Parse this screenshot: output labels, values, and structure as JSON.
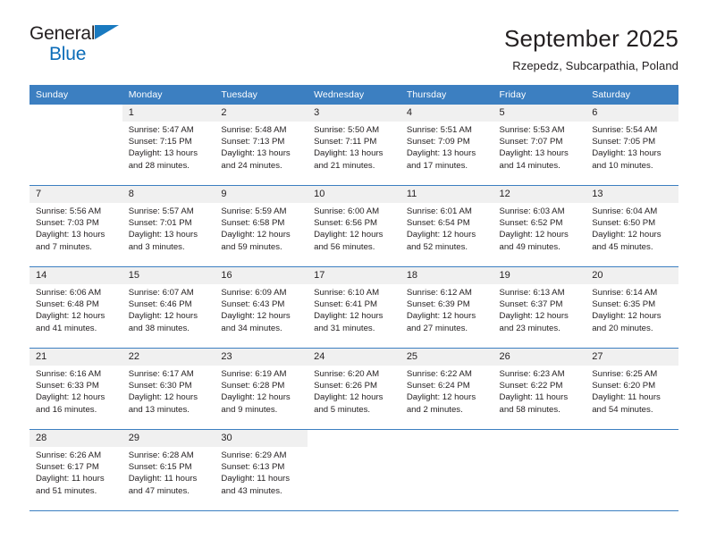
{
  "brand": {
    "word_one": "General",
    "word_two": "Blue",
    "flag_icon": "triangle-flag-icon"
  },
  "header": {
    "title": "September 2025",
    "subtitle": "Rzepedz, Subcarpathia, Poland"
  },
  "colors": {
    "header_blue": "#3c7fc1",
    "brand_blue": "#0b6cb8",
    "daynum_bg": "#f0f0f0",
    "text": "#231f20"
  },
  "weekday_headers": [
    "Sunday",
    "Monday",
    "Tuesday",
    "Wednesday",
    "Thursday",
    "Friday",
    "Saturday"
  ],
  "weeks": [
    [
      {
        "day": "",
        "sunrise": "",
        "sunset": "",
        "daylight1": "",
        "daylight2": ""
      },
      {
        "day": "1",
        "sunrise": "Sunrise: 5:47 AM",
        "sunset": "Sunset: 7:15 PM",
        "daylight1": "Daylight: 13 hours",
        "daylight2": "and 28 minutes."
      },
      {
        "day": "2",
        "sunrise": "Sunrise: 5:48 AM",
        "sunset": "Sunset: 7:13 PM",
        "daylight1": "Daylight: 13 hours",
        "daylight2": "and 24 minutes."
      },
      {
        "day": "3",
        "sunrise": "Sunrise: 5:50 AM",
        "sunset": "Sunset: 7:11 PM",
        "daylight1": "Daylight: 13 hours",
        "daylight2": "and 21 minutes."
      },
      {
        "day": "4",
        "sunrise": "Sunrise: 5:51 AM",
        "sunset": "Sunset: 7:09 PM",
        "daylight1": "Daylight: 13 hours",
        "daylight2": "and 17 minutes."
      },
      {
        "day": "5",
        "sunrise": "Sunrise: 5:53 AM",
        "sunset": "Sunset: 7:07 PM",
        "daylight1": "Daylight: 13 hours",
        "daylight2": "and 14 minutes."
      },
      {
        "day": "6",
        "sunrise": "Sunrise: 5:54 AM",
        "sunset": "Sunset: 7:05 PM",
        "daylight1": "Daylight: 13 hours",
        "daylight2": "and 10 minutes."
      }
    ],
    [
      {
        "day": "7",
        "sunrise": "Sunrise: 5:56 AM",
        "sunset": "Sunset: 7:03 PM",
        "daylight1": "Daylight: 13 hours",
        "daylight2": "and 7 minutes."
      },
      {
        "day": "8",
        "sunrise": "Sunrise: 5:57 AM",
        "sunset": "Sunset: 7:01 PM",
        "daylight1": "Daylight: 13 hours",
        "daylight2": "and 3 minutes."
      },
      {
        "day": "9",
        "sunrise": "Sunrise: 5:59 AM",
        "sunset": "Sunset: 6:58 PM",
        "daylight1": "Daylight: 12 hours",
        "daylight2": "and 59 minutes."
      },
      {
        "day": "10",
        "sunrise": "Sunrise: 6:00 AM",
        "sunset": "Sunset: 6:56 PM",
        "daylight1": "Daylight: 12 hours",
        "daylight2": "and 56 minutes."
      },
      {
        "day": "11",
        "sunrise": "Sunrise: 6:01 AM",
        "sunset": "Sunset: 6:54 PM",
        "daylight1": "Daylight: 12 hours",
        "daylight2": "and 52 minutes."
      },
      {
        "day": "12",
        "sunrise": "Sunrise: 6:03 AM",
        "sunset": "Sunset: 6:52 PM",
        "daylight1": "Daylight: 12 hours",
        "daylight2": "and 49 minutes."
      },
      {
        "day": "13",
        "sunrise": "Sunrise: 6:04 AM",
        "sunset": "Sunset: 6:50 PM",
        "daylight1": "Daylight: 12 hours",
        "daylight2": "and 45 minutes."
      }
    ],
    [
      {
        "day": "14",
        "sunrise": "Sunrise: 6:06 AM",
        "sunset": "Sunset: 6:48 PM",
        "daylight1": "Daylight: 12 hours",
        "daylight2": "and 41 minutes."
      },
      {
        "day": "15",
        "sunrise": "Sunrise: 6:07 AM",
        "sunset": "Sunset: 6:46 PM",
        "daylight1": "Daylight: 12 hours",
        "daylight2": "and 38 minutes."
      },
      {
        "day": "16",
        "sunrise": "Sunrise: 6:09 AM",
        "sunset": "Sunset: 6:43 PM",
        "daylight1": "Daylight: 12 hours",
        "daylight2": "and 34 minutes."
      },
      {
        "day": "17",
        "sunrise": "Sunrise: 6:10 AM",
        "sunset": "Sunset: 6:41 PM",
        "daylight1": "Daylight: 12 hours",
        "daylight2": "and 31 minutes."
      },
      {
        "day": "18",
        "sunrise": "Sunrise: 6:12 AM",
        "sunset": "Sunset: 6:39 PM",
        "daylight1": "Daylight: 12 hours",
        "daylight2": "and 27 minutes."
      },
      {
        "day": "19",
        "sunrise": "Sunrise: 6:13 AM",
        "sunset": "Sunset: 6:37 PM",
        "daylight1": "Daylight: 12 hours",
        "daylight2": "and 23 minutes."
      },
      {
        "day": "20",
        "sunrise": "Sunrise: 6:14 AM",
        "sunset": "Sunset: 6:35 PM",
        "daylight1": "Daylight: 12 hours",
        "daylight2": "and 20 minutes."
      }
    ],
    [
      {
        "day": "21",
        "sunrise": "Sunrise: 6:16 AM",
        "sunset": "Sunset: 6:33 PM",
        "daylight1": "Daylight: 12 hours",
        "daylight2": "and 16 minutes."
      },
      {
        "day": "22",
        "sunrise": "Sunrise: 6:17 AM",
        "sunset": "Sunset: 6:30 PM",
        "daylight1": "Daylight: 12 hours",
        "daylight2": "and 13 minutes."
      },
      {
        "day": "23",
        "sunrise": "Sunrise: 6:19 AM",
        "sunset": "Sunset: 6:28 PM",
        "daylight1": "Daylight: 12 hours",
        "daylight2": "and 9 minutes."
      },
      {
        "day": "24",
        "sunrise": "Sunrise: 6:20 AM",
        "sunset": "Sunset: 6:26 PM",
        "daylight1": "Daylight: 12 hours",
        "daylight2": "and 5 minutes."
      },
      {
        "day": "25",
        "sunrise": "Sunrise: 6:22 AM",
        "sunset": "Sunset: 6:24 PM",
        "daylight1": "Daylight: 12 hours",
        "daylight2": "and 2 minutes."
      },
      {
        "day": "26",
        "sunrise": "Sunrise: 6:23 AM",
        "sunset": "Sunset: 6:22 PM",
        "daylight1": "Daylight: 11 hours",
        "daylight2": "and 58 minutes."
      },
      {
        "day": "27",
        "sunrise": "Sunrise: 6:25 AM",
        "sunset": "Sunset: 6:20 PM",
        "daylight1": "Daylight: 11 hours",
        "daylight2": "and 54 minutes."
      }
    ],
    [
      {
        "day": "28",
        "sunrise": "Sunrise: 6:26 AM",
        "sunset": "Sunset: 6:17 PM",
        "daylight1": "Daylight: 11 hours",
        "daylight2": "and 51 minutes."
      },
      {
        "day": "29",
        "sunrise": "Sunrise: 6:28 AM",
        "sunset": "Sunset: 6:15 PM",
        "daylight1": "Daylight: 11 hours",
        "daylight2": "and 47 minutes."
      },
      {
        "day": "30",
        "sunrise": "Sunrise: 6:29 AM",
        "sunset": "Sunset: 6:13 PM",
        "daylight1": "Daylight: 11 hours",
        "daylight2": "and 43 minutes."
      },
      {
        "day": "",
        "sunrise": "",
        "sunset": "",
        "daylight1": "",
        "daylight2": ""
      },
      {
        "day": "",
        "sunrise": "",
        "sunset": "",
        "daylight1": "",
        "daylight2": ""
      },
      {
        "day": "",
        "sunrise": "",
        "sunset": "",
        "daylight1": "",
        "daylight2": ""
      },
      {
        "day": "",
        "sunrise": "",
        "sunset": "",
        "daylight1": "",
        "daylight2": ""
      }
    ]
  ]
}
